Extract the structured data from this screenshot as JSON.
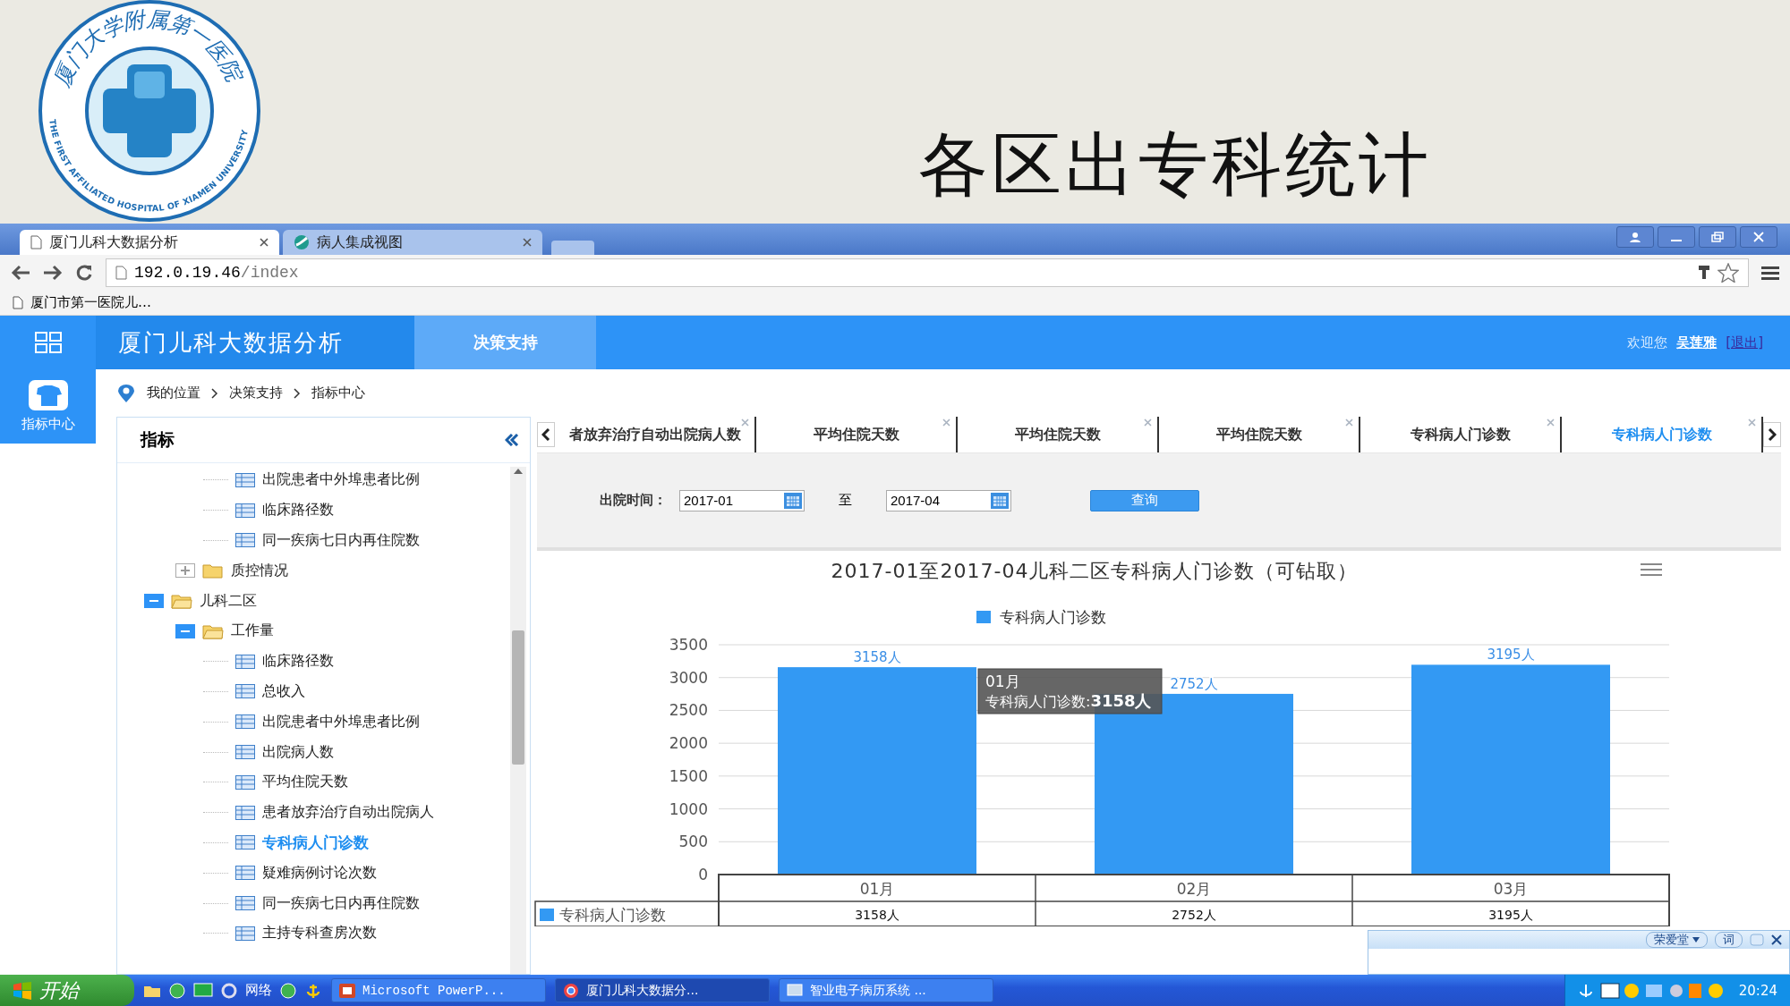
{
  "slide": {
    "logo_cn": "厦门大学附属第一医院",
    "logo_en": "THE FIRST AFFILIATED HOSPITAL OF XIAMEN UNIVERSITY",
    "title": "各区出专科统计"
  },
  "browser": {
    "tabs": [
      {
        "label": "厦门儿科大数据分析",
        "kind": "page",
        "selected": true
      },
      {
        "label": "病人集成视图",
        "kind": "web",
        "selected": false
      }
    ],
    "url_host": "192.0.19.46",
    "url_path": "/index",
    "bookmark": "厦门市第一医院儿…"
  },
  "app_header": {
    "title": "厦门儿科大数据分析",
    "menu": [
      {
        "label": "决策支持",
        "selected": true
      }
    ],
    "welcome": "欢迎您",
    "user": "吴莲雅",
    "logout": "[退出]"
  },
  "side_nav": [
    {
      "label": "指标中心",
      "selected": true
    }
  ],
  "breadcrumb": [
    "我的位置",
    "决策支持",
    "指标中心"
  ],
  "tree_panel": {
    "title": "指标",
    "tree": [
      {
        "children": [
          {
            "children": [
              {
                "label": "出院患者中外埠患者比例",
                "selected": false
              },
              {
                "label": "临床路径数",
                "selected": false
              },
              {
                "label": "同一疾病七日内再住院数",
                "selected": false
              }
            ]
          },
          {
            "label": "质控情况",
            "expanded": false
          }
        ]
      },
      {
        "label": "儿科二区",
        "expanded": true,
        "children": [
          {
            "label": "工作量",
            "expanded": true,
            "children": [
              {
                "label": "临床路径数",
                "selected": false
              },
              {
                "label": "总收入",
                "selected": false
              },
              {
                "label": "出院患者中外埠患者比例",
                "selected": false
              },
              {
                "label": "出院病人数",
                "selected": false
              },
              {
                "label": "平均住院天数",
                "selected": false
              },
              {
                "label": "患者放弃治疗自动出院病人",
                "selected": false
              },
              {
                "label": "专科病人门诊数",
                "selected": true
              },
              {
                "label": "疑难病例讨论次数",
                "selected": false
              },
              {
                "label": "同一疾病七日内再住院数",
                "selected": false
              },
              {
                "label": "主持专科查房次数",
                "selected": false
              }
            ]
          }
        ]
      }
    ]
  },
  "content_tabs": [
    {
      "label": "者放弃治疗自动出院病人数",
      "selected": false
    },
    {
      "label": "平均住院天数",
      "selected": false
    },
    {
      "label": "平均住院天数",
      "selected": false
    },
    {
      "label": "平均住院天数",
      "selected": false
    },
    {
      "label": "专科病人门诊数",
      "selected": false
    },
    {
      "label": "专科病人门诊数",
      "selected": true
    }
  ],
  "query": {
    "label": "出院时间：",
    "from": "2017-01",
    "separator": "至",
    "to": "2017-04",
    "button": "查询"
  },
  "chart": {
    "chart_data": {
      "type": "bar",
      "title": "2017-01至2017-04儿科二区专科病人门诊数（可钻取）",
      "categories": [
        "01月",
        "02月",
        "03月"
      ],
      "series": [
        {
          "name": "专科病人门诊数",
          "color": "#3399f3",
          "values": [
            3158,
            2752,
            3195
          ]
        }
      ],
      "ylim": [
        0,
        3500
      ],
      "grid": true,
      "yticks": [
        0,
        500,
        1000,
        1500,
        2000,
        2500,
        3000,
        3500
      ],
      "value_labels": [
        "3158人",
        "2752人",
        "3195人"
      ]
    },
    "tooltip": {
      "title": "01月",
      "label": "专科病人门诊数:",
      "value": "3158人"
    },
    "data_table": {
      "legend": "专科病人门诊数",
      "cells": [
        "3158人",
        "2752人",
        "3195人"
      ]
    }
  },
  "ime_bar": {
    "name": "荣爱堂",
    "button": "词"
  },
  "taskbar": {
    "start": "开始",
    "quick_label": "网络",
    "tasks": [
      {
        "label": "Microsoft PowerP...",
        "kind": "ppt",
        "selected": false
      },
      {
        "label": "厦门儿科大数据分...",
        "kind": "browser",
        "selected": true
      },
      {
        "label": "智业电子病历系统 ...",
        "kind": "app",
        "selected": false
      }
    ],
    "clock": "20:24"
  }
}
